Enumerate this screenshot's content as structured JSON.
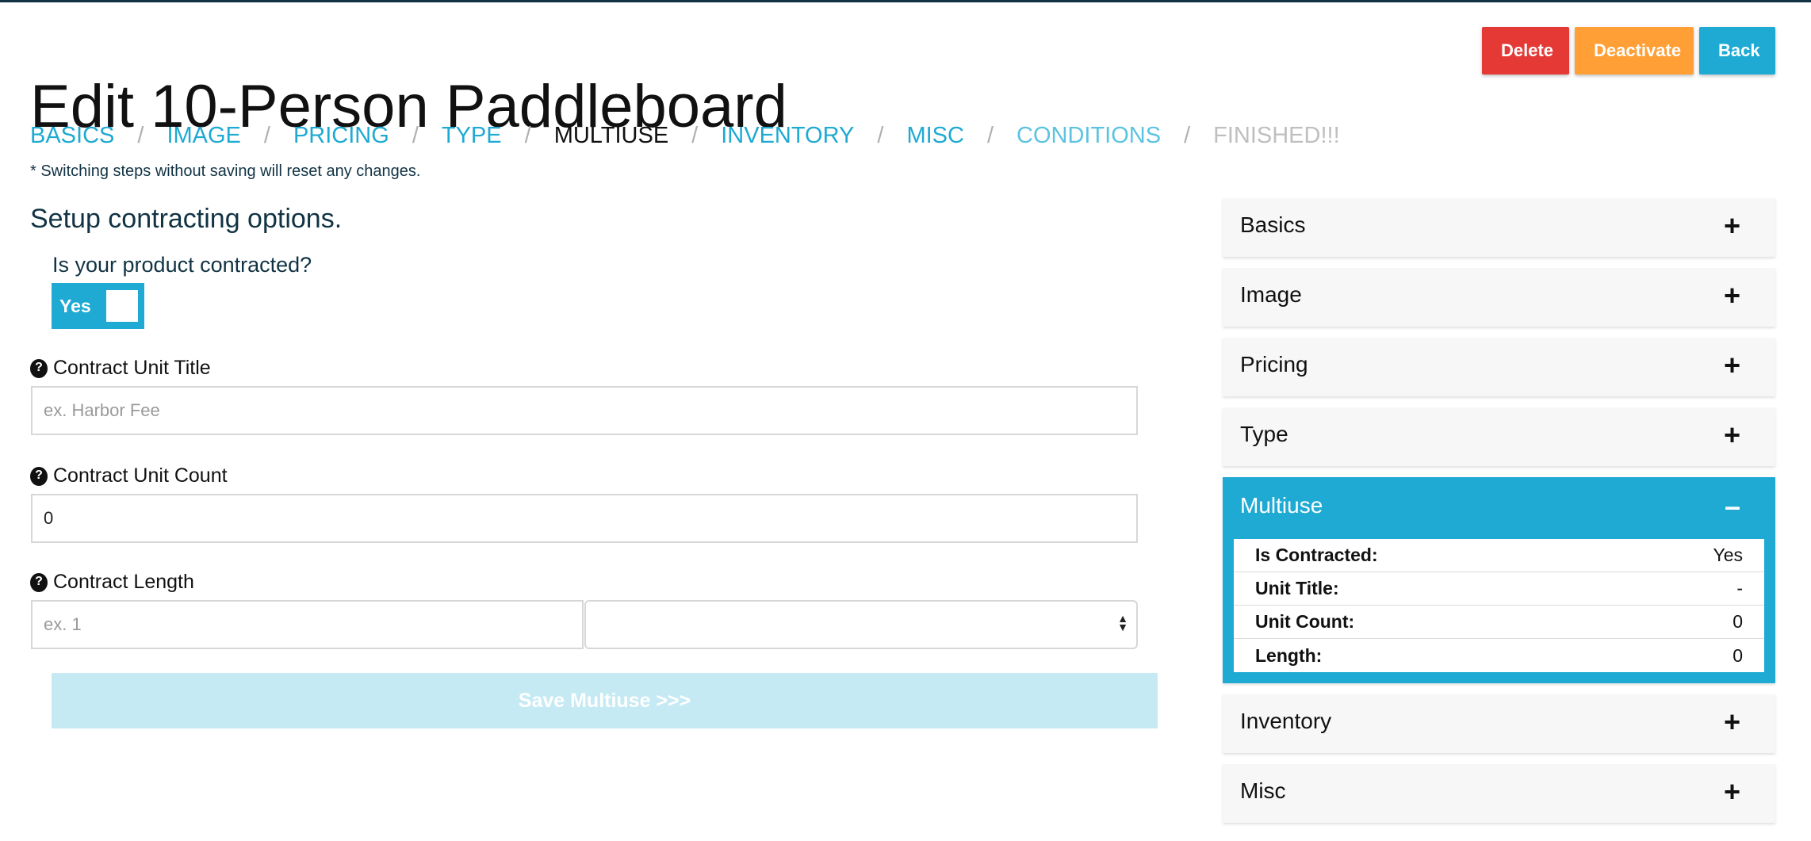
{
  "page": {
    "title": "Edit 10-Person Paddleboard"
  },
  "actions": {
    "delete": "Delete",
    "deactivate": "Deactivate",
    "back": "Back"
  },
  "steps": [
    "BASICS",
    "IMAGE",
    "PRICING",
    "TYPE",
    "MULTIUSE",
    "INVENTORY",
    "MISC",
    "CONDITIONS",
    "FINISHED!!!"
  ],
  "step_separator": "/",
  "current_step": "MULTIUSE",
  "note": "* Switching steps without saving will reset any changes.",
  "form": {
    "section_title": "Setup contracting options.",
    "question": "Is your product contracted?",
    "toggle_label": "Yes",
    "help_glyph": "?",
    "unit_title": {
      "label": "Contract Unit Title",
      "placeholder": "ex. Harbor Fee",
      "value": ""
    },
    "unit_count": {
      "label": "Contract Unit Count",
      "value": "0"
    },
    "length": {
      "label": "Contract Length",
      "placeholder": "ex. 1",
      "value": "",
      "unit_selected": ""
    },
    "save_label": "Save Multiuse >>>"
  },
  "sidebar": {
    "items": [
      {
        "title": "Basics",
        "sign": "+"
      },
      {
        "title": "Image",
        "sign": "+"
      },
      {
        "title": "Pricing",
        "sign": "+"
      },
      {
        "title": "Type",
        "sign": "+"
      }
    ],
    "open": {
      "title": "Multiuse",
      "sign": "–",
      "rows": [
        {
          "key": "Is Contracted:",
          "value": "Yes"
        },
        {
          "key": "Unit Title:",
          "value": "-"
        },
        {
          "key": "Unit Count:",
          "value": "0"
        },
        {
          "key": "Length:",
          "value": "0"
        }
      ]
    },
    "after": [
      {
        "title": "Inventory",
        "sign": "+"
      },
      {
        "title": "Misc",
        "sign": "+"
      }
    ]
  },
  "colors": {
    "accent": "#1eaad3",
    "delete": "#e53935",
    "deactivate": "#ff9f35",
    "save_disabled": "#c6eaf4",
    "text_dark": "#113344"
  }
}
